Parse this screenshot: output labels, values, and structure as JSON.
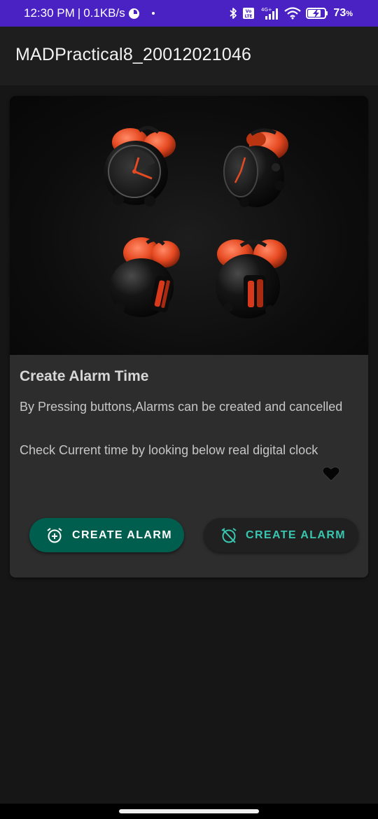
{
  "status_bar": {
    "time": "12:30 PM",
    "separator": "|",
    "network_speed": "0.1KB/s",
    "battery_percent": "73",
    "battery_unit": "%",
    "icons": [
      "data-saver-icon",
      "notification-dot-icon",
      "bluetooth-icon",
      "volte-icon",
      "signal-icon",
      "wifi-icon",
      "battery-charging-icon"
    ],
    "colors": {
      "background": "#4a22c4"
    }
  },
  "app_bar": {
    "title": "MADPractical8_20012021046"
  },
  "card": {
    "image_icon": "alarm-clocks-image",
    "title": "Create Alarm Time",
    "description": "By Pressing buttons,Alarms can be created and cancelled",
    "clock_hint": "Check Current time by looking below real digital clock",
    "heart_icon": "heart-icon",
    "buttons": {
      "create_label": "CREATE ALARM",
      "create_icon": "alarm-add-icon",
      "cancel_label": "CREATE ALARM",
      "cancel_icon": "alarm-off-icon"
    },
    "colors": {
      "create_button": "#005e4f",
      "cancel_button_text": "#39c6b0",
      "card": "#2d2d2d"
    }
  },
  "theme": {
    "background": "#161616",
    "accent": "#39c6b0"
  }
}
